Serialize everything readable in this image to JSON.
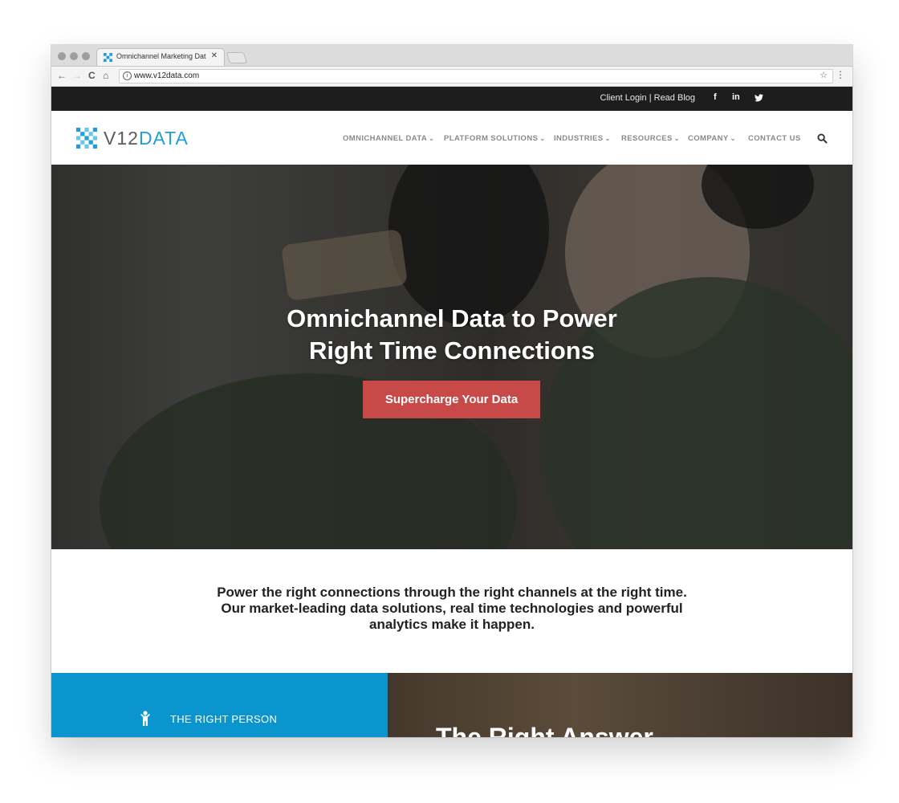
{
  "browser": {
    "tab_title": "Omnichannel Marketing Data S",
    "tab_close": "✕",
    "url": "www.v12data.com",
    "back": "←",
    "forward": "→",
    "reload": "C",
    "home": "⌂",
    "info": "i",
    "star": "☆",
    "menu": "⋮"
  },
  "topbar": {
    "client_login": "Client Login",
    "separator": "|",
    "read_blog": "Read Blog",
    "social": [
      "f",
      "in",
      "🐦"
    ]
  },
  "logo": {
    "part1": "V12",
    "part2": "DATA"
  },
  "nav": {
    "items": [
      {
        "label": "OMNICHANNEL DATA",
        "chevron": "⌄"
      },
      {
        "label": "PLATFORM SOLUTIONS",
        "chevron": "⌄"
      },
      {
        "label": "INDUSTRIES",
        "chevron": "⌄"
      },
      {
        "label": "RESOURCES",
        "chevron": "⌄"
      },
      {
        "label": "COMPANY",
        "chevron": "⌄"
      },
      {
        "label": "CONTACT US",
        "chevron": ""
      }
    ]
  },
  "hero": {
    "title_line1": "Omnichannel Data to Power",
    "title_line2": "Right Time Connections",
    "cta_label": "Supercharge Your Data"
  },
  "intro": {
    "line1": "Power the right connections through the right channels at the right time.",
    "line2": "Our market-leading data solutions, real time technologies and powerful",
    "line3": "analytics make it happen."
  },
  "panels": {
    "left_label": "THE RIGHT PERSON",
    "right_heading": "The Right Answer"
  },
  "colors": {
    "brand_blue": "#1e9fd6",
    "cta_red": "#c74a48",
    "topbar_bg": "#1d1d1d",
    "panel_blue": "#0b95cf"
  }
}
